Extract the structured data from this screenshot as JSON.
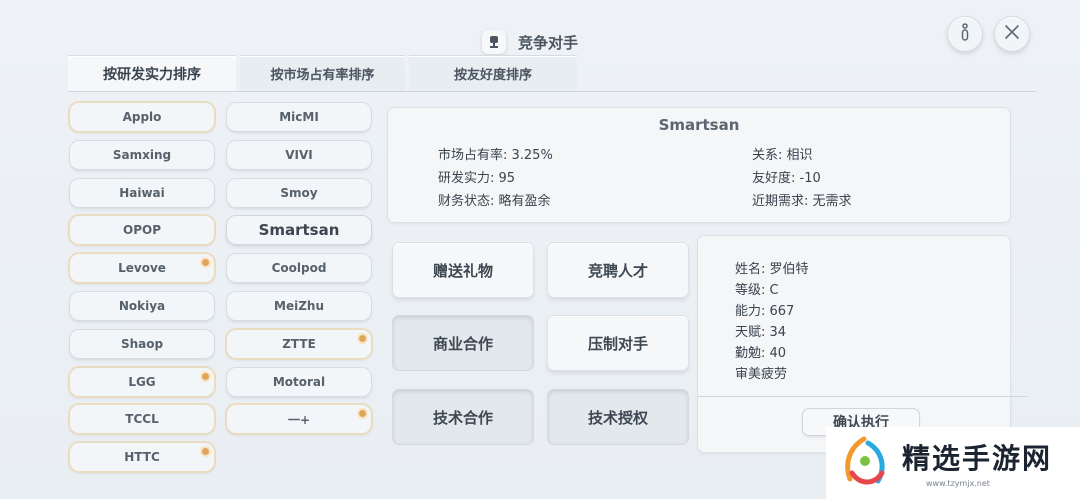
{
  "header": {
    "title": "竞争对手"
  },
  "tabs": [
    {
      "label": "按研发实力排序",
      "active": true
    },
    {
      "label": "按市场占有率排序",
      "active": false
    },
    {
      "label": "按友好度排序",
      "active": false
    }
  ],
  "companies": [
    {
      "name": "Applo",
      "highlight": true,
      "dot": false
    },
    {
      "name": "Samxing",
      "highlight": false,
      "dot": false
    },
    {
      "name": "Haiwai",
      "highlight": false,
      "dot": false
    },
    {
      "name": "OPOP",
      "highlight": true,
      "dot": false
    },
    {
      "name": "Levove",
      "highlight": true,
      "dot": true
    },
    {
      "name": "Nokiya",
      "highlight": false,
      "dot": false
    },
    {
      "name": "Shaop",
      "highlight": false,
      "dot": false
    },
    {
      "name": "LGG",
      "highlight": true,
      "dot": true
    },
    {
      "name": "TCCL",
      "highlight": true,
      "dot": false
    },
    {
      "name": "HTTC",
      "highlight": true,
      "dot": true
    },
    {
      "name": "MicMI",
      "highlight": false,
      "dot": false
    },
    {
      "name": "VIVI",
      "highlight": false,
      "dot": false
    },
    {
      "name": "Smoy",
      "highlight": false,
      "dot": false
    },
    {
      "name": "Smartsan",
      "highlight": false,
      "dot": false,
      "selected": true
    },
    {
      "name": "Coolpod",
      "highlight": false,
      "dot": false
    },
    {
      "name": "MeiZhu",
      "highlight": false,
      "dot": false
    },
    {
      "name": "ZTTE",
      "highlight": true,
      "dot": true
    },
    {
      "name": "Motoral",
      "highlight": false,
      "dot": false
    },
    {
      "name": "一+",
      "highlight": true,
      "dot": true
    }
  ],
  "info": {
    "name": "Smartsan",
    "market_share": "市场占有率: 3.25%",
    "rd_strength": "研发实力: 95",
    "finance": "财务状态: 略有盈余",
    "relation": "关系: 相识",
    "friendliness": "友好度: -10",
    "demand": "近期需求: 无需求"
  },
  "actions": [
    {
      "label": "赠送礼物",
      "pressed": false
    },
    {
      "label": "竞聘人才",
      "pressed": false
    },
    {
      "label": "商业合作",
      "pressed": true
    },
    {
      "label": "压制对手",
      "pressed": false
    },
    {
      "label": "技术合作",
      "pressed": true
    },
    {
      "label": "技术授权",
      "pressed": true
    }
  ],
  "talent": {
    "name": "姓名: 罗伯特",
    "level": "等级: C",
    "ability": "能力: 667",
    "talent": "天赋: 34",
    "diligence": "勤勉: 40",
    "state": "审美疲劳",
    "confirm": "确认执行"
  },
  "watermark": {
    "text": "精选手游网",
    "url": "www.tzymjx.net"
  },
  "colors": {
    "dot": "#e0a55c",
    "highlight_border": "#e9dcbf"
  }
}
